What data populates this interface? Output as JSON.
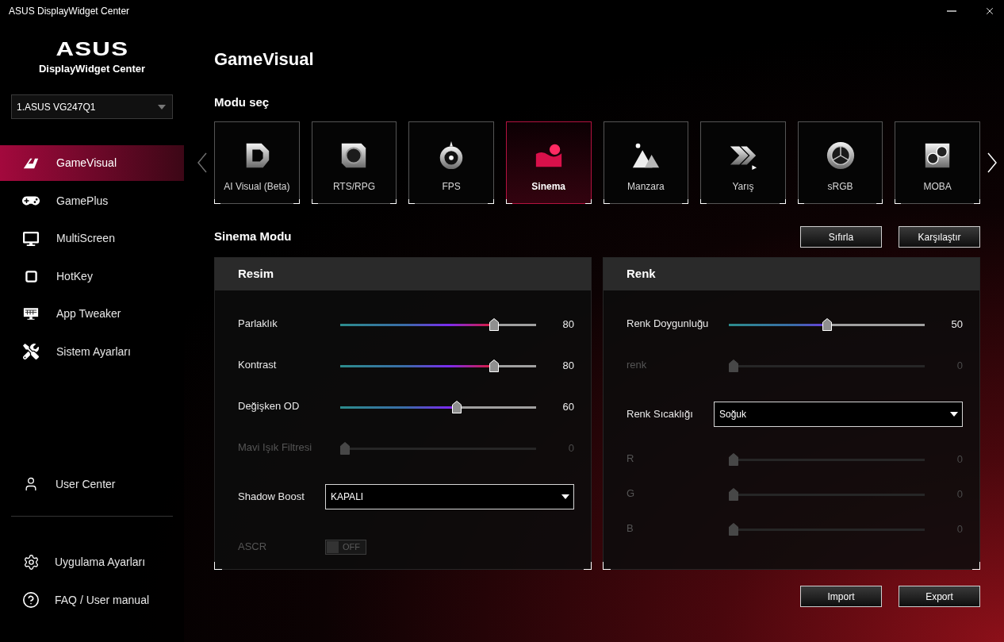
{
  "window": {
    "title": "ASUS DisplayWidget Center"
  },
  "sidebar": {
    "logo": {
      "wordmark": "ASUS",
      "subtitle": "DisplayWidget Center"
    },
    "monitor_select": {
      "value": "1.ASUS VG247Q1"
    },
    "nav_items": [
      {
        "label": "GameVisual",
        "selected": true
      },
      {
        "label": "GamePlus",
        "selected": false
      },
      {
        "label": "MultiScreen",
        "selected": false
      },
      {
        "label": "HotKey",
        "selected": false
      },
      {
        "label": "App Tweaker",
        "selected": false
      },
      {
        "label": "Sistem Ayarları",
        "selected": false
      }
    ],
    "user_center": {
      "label": "User Center"
    },
    "footer_items": [
      {
        "label": "Uygulama Ayarları"
      },
      {
        "label": "FAQ / User manual"
      }
    ]
  },
  "page": {
    "title": "GameVisual",
    "mode_heading": "Modu seç"
  },
  "modes": [
    {
      "label": "AI Visual (Beta)",
      "selected": false
    },
    {
      "label": "RTS/RPG",
      "selected": false
    },
    {
      "label": "FPS",
      "selected": false
    },
    {
      "label": "Sinema",
      "selected": true
    },
    {
      "label": "Manzara",
      "selected": false
    },
    {
      "label": "Yarış",
      "selected": false
    },
    {
      "label": "sRGB",
      "selected": false
    },
    {
      "label": "MOBA",
      "selected": false
    }
  ],
  "mode_settings": {
    "title": "Sinema Modu",
    "buttons": [
      "Sıfırla",
      "Karşılaştır"
    ]
  },
  "panels": [
    {
      "title": "Resim",
      "rows": [
        {
          "kind": "slider",
          "label": "Parlaklık",
          "level": 0.8,
          "reading": "80",
          "disabled": false
        },
        {
          "kind": "slider",
          "label": "Kontrast",
          "level": 0.8,
          "reading": "80",
          "disabled": false
        },
        {
          "kind": "slider",
          "label": "Değişken OD",
          "level": 0.6,
          "reading": "60",
          "disabled": false
        },
        {
          "kind": "slider",
          "label": "Mavi Işık Filtresi",
          "level": 0,
          "reading": "0",
          "disabled": true
        },
        {
          "kind": "dropdown",
          "label": "Shadow Boost",
          "value": "KAPALI",
          "disabled": false
        },
        {
          "kind": "toggle",
          "label": "ASCR",
          "on": false,
          "state_label": "OFF",
          "disabled": true
        }
      ]
    },
    {
      "title": "Renk",
      "rows": [
        {
          "kind": "slider",
          "label": "Renk Doygunluğu",
          "level": 0.5,
          "reading": "50",
          "disabled": false
        },
        {
          "kind": "slider",
          "label": "renk",
          "level": 0,
          "reading": "0",
          "disabled": true
        },
        {
          "kind": "dropdown",
          "label": "Renk Sıcaklığı",
          "value": "Soğuk",
          "disabled": false
        },
        {
          "kind": "slider",
          "label": "R",
          "level": 0,
          "reading": "0",
          "disabled": true
        },
        {
          "kind": "slider",
          "label": "G",
          "level": 0,
          "reading": "0",
          "disabled": true
        },
        {
          "kind": "slider",
          "label": "B",
          "level": 0,
          "reading": "0",
          "disabled": true
        }
      ]
    }
  ],
  "footer_buttons": [
    "Import",
    "Export"
  ]
}
